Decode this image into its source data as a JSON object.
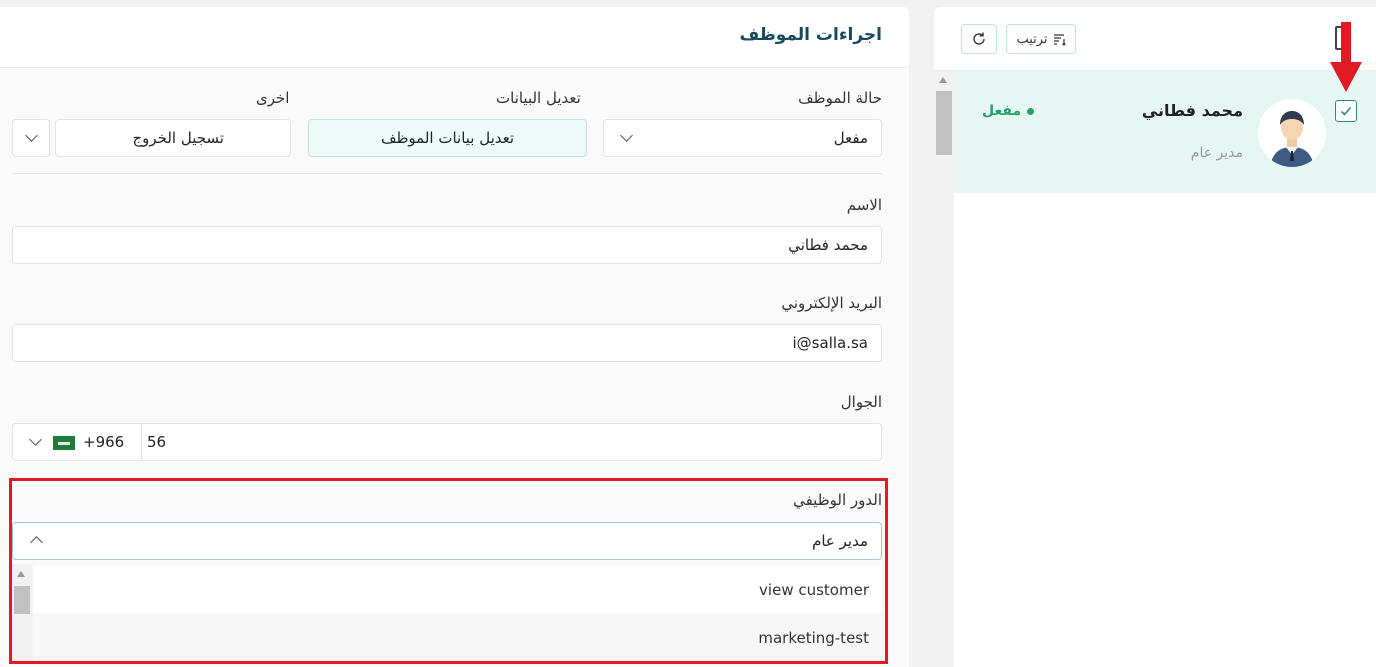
{
  "list": {
    "refresh_icon": "refresh-icon",
    "sort_label": "ترتيب",
    "sort_icon": "sort-icon",
    "employee": {
      "name": "محمد فطاني",
      "role": "مدير عام",
      "status": "مفعل",
      "status_color": "#26a269",
      "selected": true
    }
  },
  "actions": {
    "title": "اجراءات الموظف",
    "status_label": "حالة الموظف",
    "status_value": "مفعل",
    "edit_label": "تعديل البيانات",
    "edit_button": "تعديل بيانات الموظف",
    "other_label": "اخرى",
    "other_value": "تسجيل الخروج",
    "name_label": "الاسم",
    "name_value": "محمد فطاني",
    "email_label": "البريد الإلكتروني",
    "email_value": "i@salla.sa",
    "mobile_label": "الجوال",
    "mobile_value": "56",
    "country_code": "+966",
    "role_label": "الدور الوظيفي",
    "role_value": "مدير عام",
    "role_options": [
      "view customer",
      "marketing-test"
    ]
  },
  "colors": {
    "accent": "#154a5a",
    "selected_row": "#e6f7f3",
    "highlight": "#e01b24"
  }
}
